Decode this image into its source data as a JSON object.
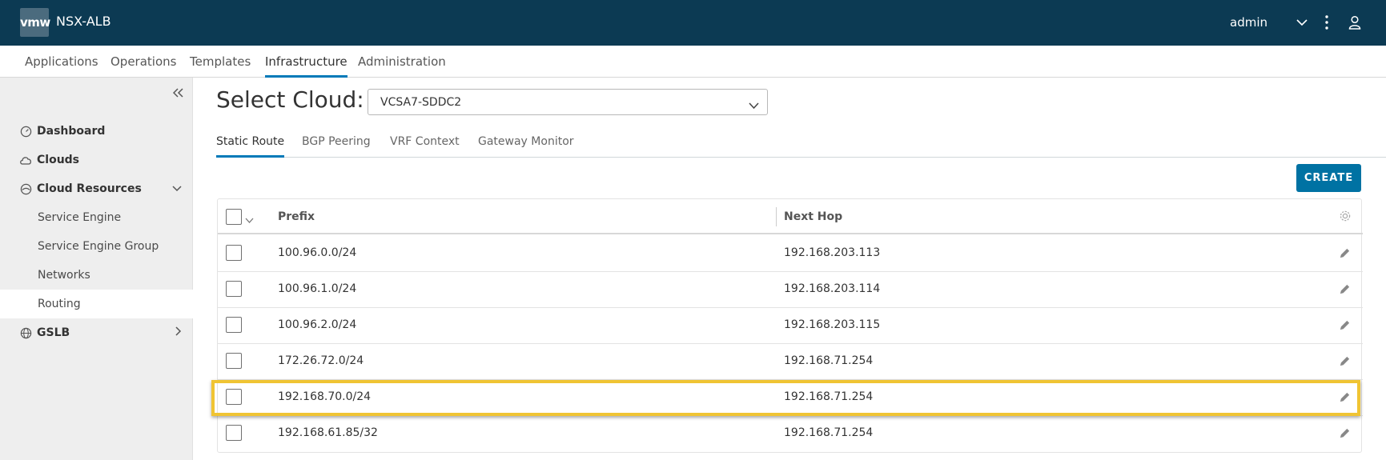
{
  "header": {
    "logo": "vmw",
    "app_name": "NSX-ALB",
    "user": "admin",
    "icons": [
      "chevron-down-icon",
      "more-vertical-icon",
      "user-icon"
    ]
  },
  "topnav": {
    "items": [
      "Applications",
      "Operations",
      "Templates",
      "Infrastructure",
      "Administration"
    ],
    "active": "Infrastructure"
  },
  "sidebar": {
    "items": [
      {
        "label": "Dashboard",
        "icon": "dashboard-icon"
      },
      {
        "label": "Clouds",
        "icon": "cloud-icon"
      },
      {
        "label": "Cloud Resources",
        "icon": "cloud-resources-icon"
      },
      {
        "label": "Service Engine"
      },
      {
        "label": "Service Engine Group"
      },
      {
        "label": "Networks"
      },
      {
        "label": "Routing"
      },
      {
        "label": "GSLB",
        "icon": "globe-icon"
      }
    ],
    "selected": "Routing"
  },
  "cloud": {
    "label": "Select Cloud:",
    "value": "VCSA7-SDDC2"
  },
  "tabs": {
    "items": [
      "Static Route",
      "BGP Peering",
      "VRF Context",
      "Gateway Monitor"
    ],
    "active": "Static Route"
  },
  "toolbar": {
    "create_label": "CREATE"
  },
  "table": {
    "columns": [
      "Prefix",
      "Next Hop"
    ],
    "rows": [
      {
        "prefix": "100.96.0.0/24",
        "next_hop": "192.168.203.113"
      },
      {
        "prefix": "100.96.1.0/24",
        "next_hop": "192.168.203.114"
      },
      {
        "prefix": "100.96.2.0/24",
        "next_hop": "192.168.203.115"
      },
      {
        "prefix": "172.26.72.0/24",
        "next_hop": "192.168.71.254"
      },
      {
        "prefix": "192.168.70.0/24",
        "next_hop": "192.168.71.254"
      },
      {
        "prefix": "192.168.61.85/32",
        "next_hop": "192.168.71.254"
      }
    ],
    "highlighted_row": "192.168.70.0/24",
    "highlight_color": "#f0c433"
  },
  "colors": {
    "header_bg": "#0c3a53",
    "accent": "#0079b8",
    "button": "#0072a3"
  }
}
